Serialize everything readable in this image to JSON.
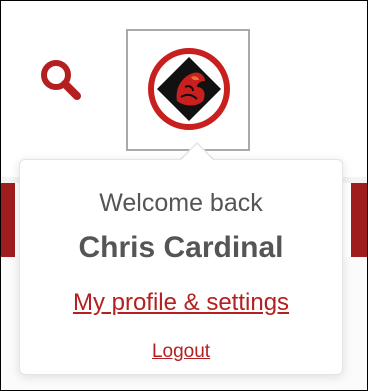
{
  "header": {
    "search_icon": "search-icon",
    "avatar_icon": "cardinal-logo-icon"
  },
  "user_menu": {
    "welcome_text": "Welcome back",
    "user_name": "Chris Cardinal",
    "profile_link": "My profile & settings",
    "logout_link": "Logout"
  },
  "colors": {
    "accent": "#b41f1f",
    "text": "#555555",
    "avatar_border": "#a9a9a9"
  }
}
